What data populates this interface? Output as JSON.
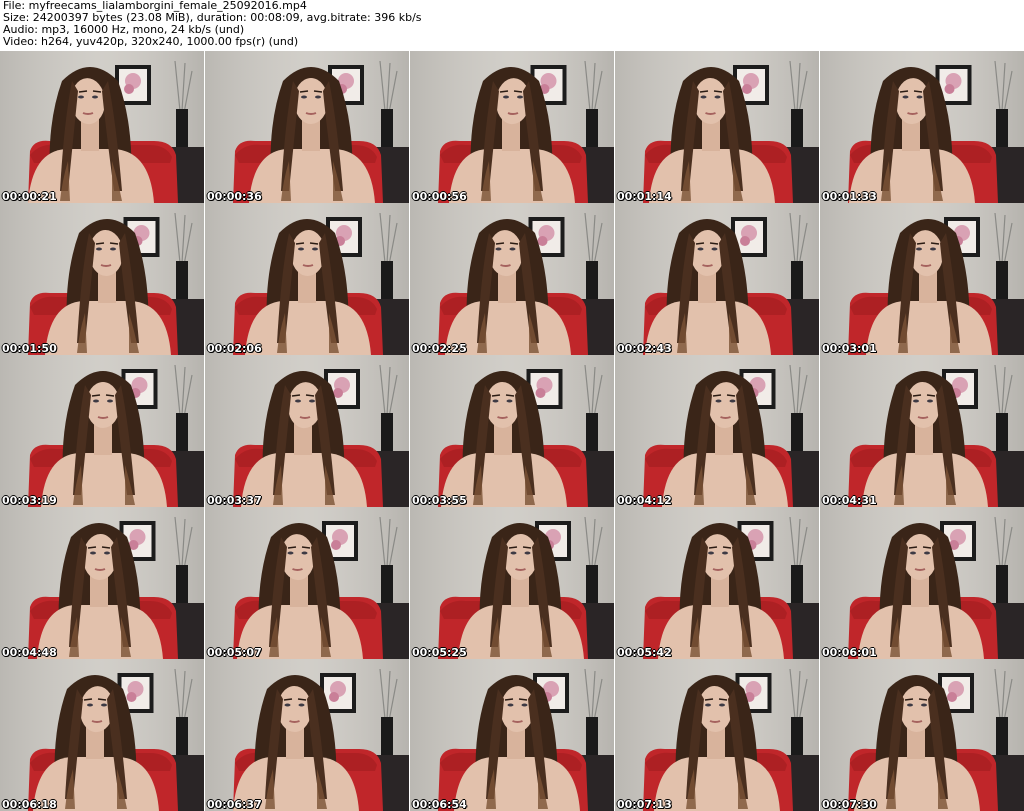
{
  "header": {
    "file_line": "File: myfreecams_lialamborgini_female_25092016.mp4",
    "size_line": "Size: 24200397 bytes (23.08 MiB), duration: 00:08:09, avg.bitrate: 396 kb/s",
    "audio_line": "Audio: mp3, 16000 Hz, mono, 24 kb/s (und)",
    "video_line": "Video: h264, yuv420p, 320x240, 1000.00 fps(r) (und)"
  },
  "thumbnails": [
    {
      "timestamp": "00:00:21"
    },
    {
      "timestamp": "00:00:36"
    },
    {
      "timestamp": "00:00:56"
    },
    {
      "timestamp": "00:01:14"
    },
    {
      "timestamp": "00:01:33"
    },
    {
      "timestamp": "00:01:50"
    },
    {
      "timestamp": "00:02:06"
    },
    {
      "timestamp": "00:02:25"
    },
    {
      "timestamp": "00:02:43"
    },
    {
      "timestamp": "00:03:01"
    },
    {
      "timestamp": "00:03:19"
    },
    {
      "timestamp": "00:03:37"
    },
    {
      "timestamp": "00:03:55"
    },
    {
      "timestamp": "00:04:12"
    },
    {
      "timestamp": "00:04:31"
    },
    {
      "timestamp": "00:04:48"
    },
    {
      "timestamp": "00:05:07"
    },
    {
      "timestamp": "00:05:25"
    },
    {
      "timestamp": "00:05:42"
    },
    {
      "timestamp": "00:06:01"
    },
    {
      "timestamp": "00:06:18"
    },
    {
      "timestamp": "00:06:37"
    },
    {
      "timestamp": "00:06:54"
    },
    {
      "timestamp": "00:07:13"
    },
    {
      "timestamp": "00:07:30"
    }
  ],
  "colors": {
    "wall": "#cfccc6",
    "chair": "#c0262a",
    "hair": "#3a2518",
    "skin": "#e2c1ac",
    "frame": "#1c1c1c",
    "flower": "#d9a2b4",
    "timestamp_text": "#ffffff"
  }
}
